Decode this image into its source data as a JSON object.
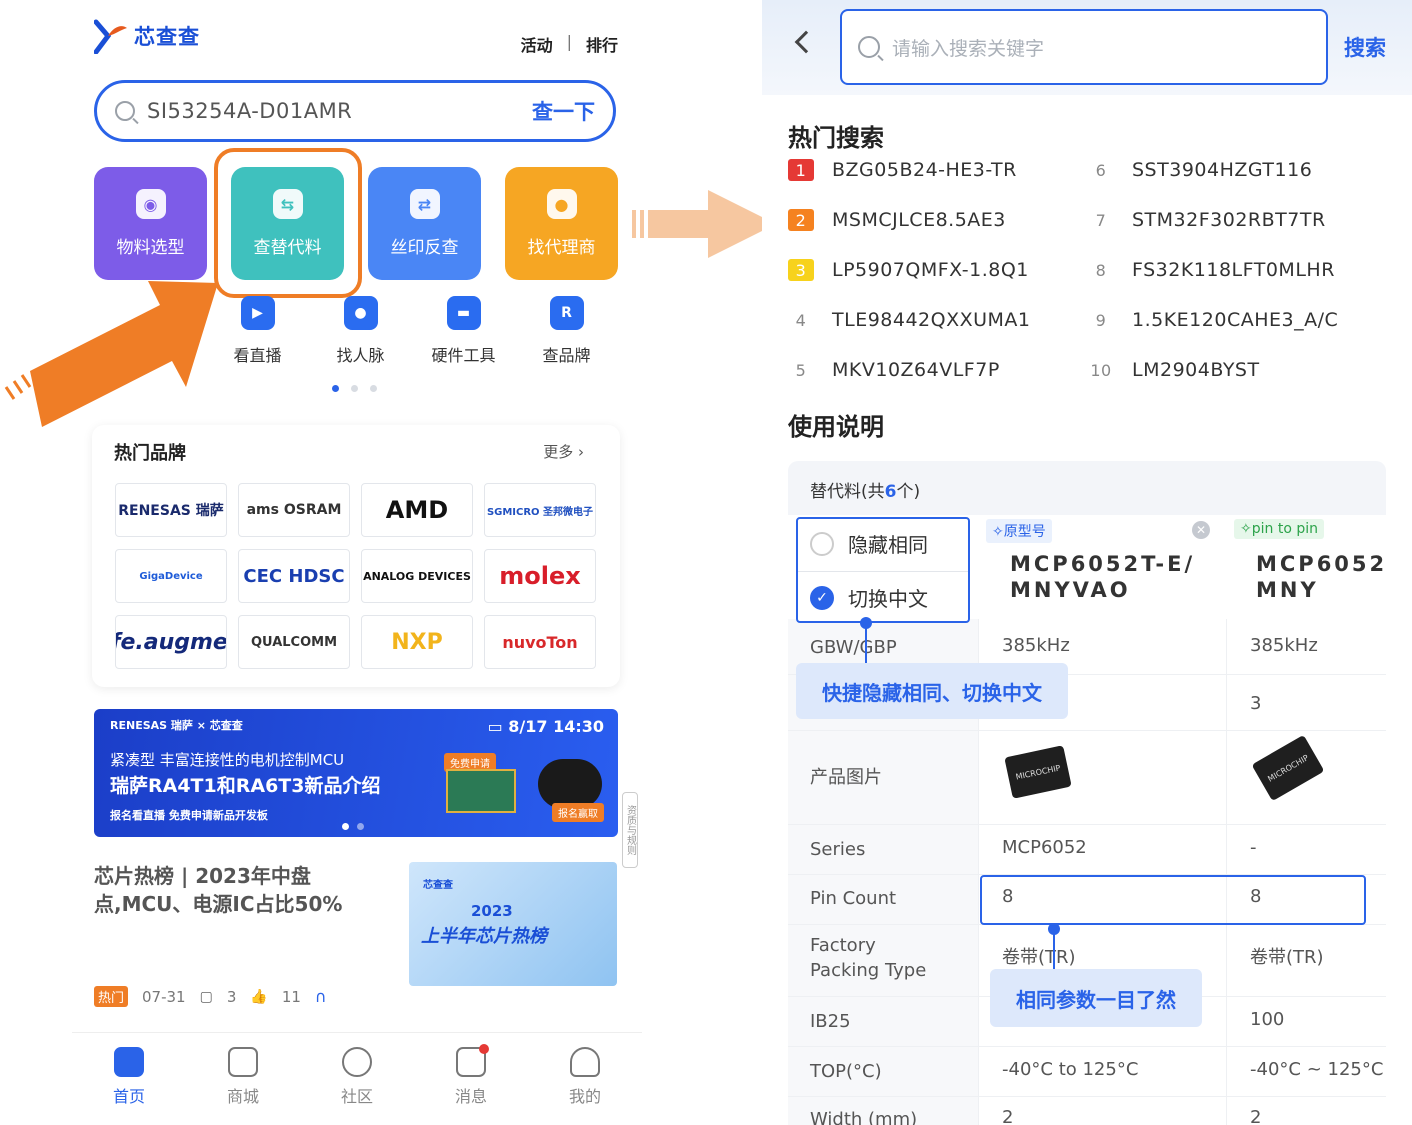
{
  "left": {
    "brand_name": "芯查查",
    "top_links": [
      "活动",
      "排行"
    ],
    "search": {
      "value": "SI53254A-D01AMR",
      "action": "查一下"
    },
    "tiles": [
      {
        "label": "物料选型",
        "icon": "material-select-icon",
        "color": "#7d5ce8"
      },
      {
        "label": "查替代料",
        "icon": "substitute-icon",
        "color": "#3fc1be",
        "highlighted": true
      },
      {
        "label": "丝印反查",
        "icon": "marking-lookup-icon",
        "color": "#4a86f5"
      },
      {
        "label": "找代理商",
        "icon": "agent-icon",
        "color": "#f6a623"
      }
    ],
    "small_items": [
      {
        "label": "看直播",
        "icon": "live-icon"
      },
      {
        "label": "找人脉",
        "icon": "contacts-icon"
      },
      {
        "label": "硬件工具",
        "icon": "toolbox-icon"
      },
      {
        "label": "查品牌",
        "icon": "brand-icon"
      }
    ],
    "brands": {
      "title": "热门品牌",
      "more": "更多",
      "items": [
        {
          "name": "RENESAS 瑞萨",
          "cls": "b-renesas"
        },
        {
          "name": "ams OSRAM",
          "cls": "b-osram"
        },
        {
          "name": "AMD",
          "cls": "b-amd"
        },
        {
          "name": "SGMICRO 圣邦微电子",
          "cls": "b-sgmicro"
        },
        {
          "name": "GigaDevice",
          "cls": "b-giga"
        },
        {
          "name": "CEC HDSC",
          "cls": "b-hdsc"
        },
        {
          "name": "ANALOG DEVICES",
          "cls": "b-adi"
        },
        {
          "name": "molex",
          "cls": "b-molex"
        },
        {
          "name": "ST life.augmented",
          "cls": "b-st"
        },
        {
          "name": "QUALCOMM",
          "cls": "b-qualcomm"
        },
        {
          "name": "NXP",
          "cls": "b-nxp"
        },
        {
          "name": "nuvoTon",
          "cls": "b-nuvoton"
        }
      ]
    },
    "banner": {
      "logos": "RENESAS 瑞萨 × 芯查查",
      "date": "8/17 14:30",
      "subtitle": "紧凑型 丰富连接性的电机控制MCU",
      "title": "瑞萨RA4T1和RA6T3新品介绍",
      "tagline": "报名看直播 免费申请新品开发板",
      "free_badge": "免费申请",
      "grab_badge": "报名赢取"
    },
    "side_tab": "资质与规则",
    "article": {
      "title": "芯片热榜 | 2023年中盘点,MCU、电源IC占比50%",
      "thumb_brand": "芯查查",
      "thumb_year": "2023",
      "thumb_title": "上半年芯片热榜",
      "badge": "热门",
      "date": "07-31",
      "comments": "3",
      "likes": "11"
    },
    "tabbar": [
      {
        "label": "首页",
        "icon": "home-icon",
        "active": true
      },
      {
        "label": "商城",
        "icon": "shop-icon"
      },
      {
        "label": "社区",
        "icon": "community-icon"
      },
      {
        "label": "消息",
        "icon": "message-icon",
        "badge": true
      },
      {
        "label": "我的",
        "icon": "profile-icon"
      }
    ]
  },
  "right": {
    "search": {
      "placeholder": "请输入搜索关键字",
      "button": "搜索"
    },
    "hot_title": "热门搜索",
    "hot": [
      {
        "rank": "1",
        "part": "BZG05B24-HE3-TR"
      },
      {
        "rank": "2",
        "part": "MSMCJLCE8.5AE3"
      },
      {
        "rank": "3",
        "part": "LP5907QMFX-1.8Q1"
      },
      {
        "rank": "4",
        "part": "TLE98442QXXUMA1"
      },
      {
        "rank": "5",
        "part": "MKV10Z64VLF7P"
      },
      {
        "rank": "6",
        "part": "SST3904HZGT116"
      },
      {
        "rank": "7",
        "part": "STM32F302RBT7TR"
      },
      {
        "rank": "8",
        "part": "FS32K118LFT0MLHR"
      },
      {
        "rank": "9",
        "part": "1.5KE120CAHE3_A/C"
      },
      {
        "rank": "10",
        "part": "LM2904BYST"
      }
    ],
    "usage_title": "使用说明",
    "compare": {
      "header_prefix": "替代料(共",
      "header_count": "6",
      "header_suffix": "个)",
      "opt_hide": "隐藏相同",
      "opt_cn": "切换中文",
      "col_b": {
        "tag": "原型号",
        "model": "MCP6052T-E/ MNYVAO"
      },
      "col_c": {
        "tag": "pin to pin",
        "model": "MCP6052 MNY"
      },
      "rows": [
        {
          "label": "GBW/GBP",
          "b": "385kHz",
          "c": "385kHz"
        },
        {
          "label": "",
          "b": "",
          "c": "3"
        },
        {
          "label": "产品图片",
          "b": "",
          "c": ""
        },
        {
          "label": "Series",
          "b": "MCP6052",
          "c": "-"
        },
        {
          "label": "Pin Count",
          "b": "8",
          "c": "8"
        },
        {
          "label": "Factory Packing Type",
          "b": "卷带(TR)",
          "c": "卷带(TR)"
        },
        {
          "label": "IB25",
          "b": "",
          "c": "100"
        },
        {
          "label": "TOP(°C)",
          "b": "-40°C to 125°C",
          "c": "-40°C ~ 125°C"
        },
        {
          "label": "Width (mm)",
          "b": "2",
          "c": "2"
        }
      ],
      "chip_b": "MICROCHIP",
      "chip_c": "MICROCHIP",
      "tip1": "快捷隐藏相同、切换中文",
      "tip2": "相同参数一目了然"
    }
  },
  "colors": {
    "accent": "#2a63e8",
    "highlight": "#ef7d26",
    "arrow": "#f6c7a0"
  }
}
